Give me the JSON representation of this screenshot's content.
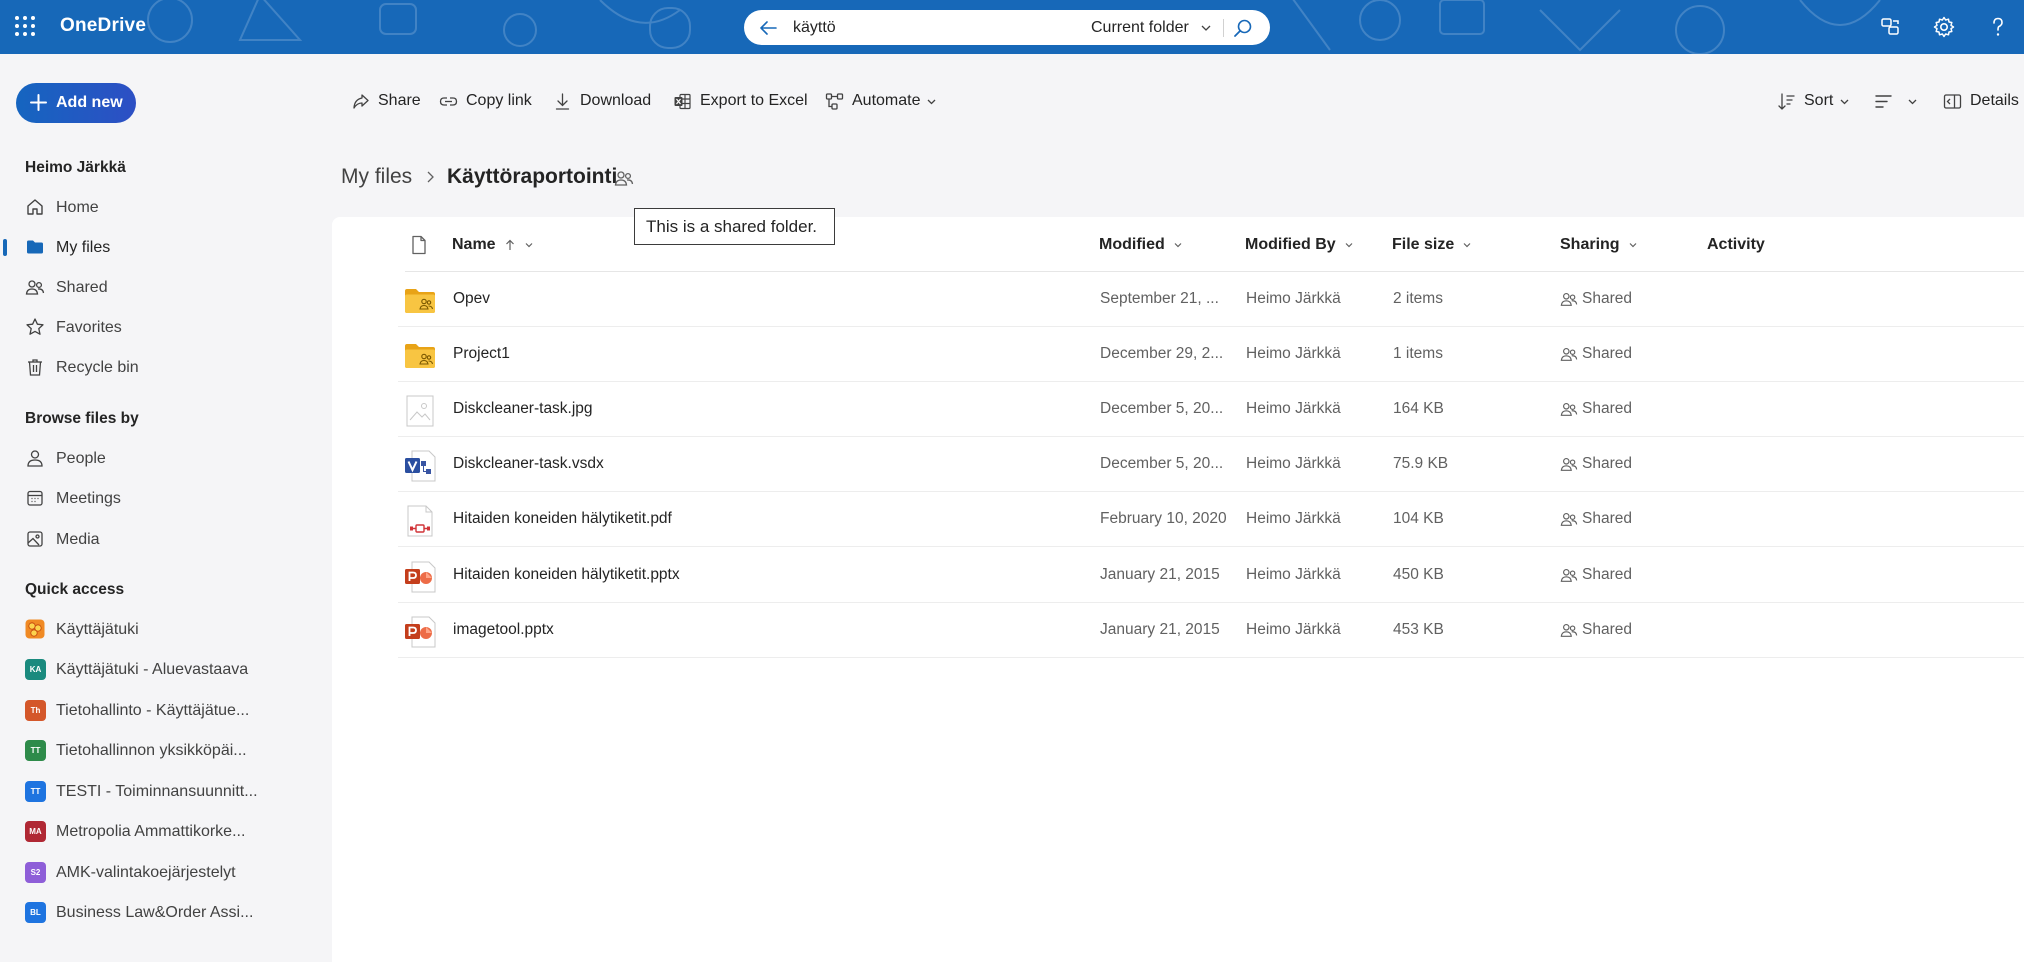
{
  "app": {
    "brand": "OneDrive"
  },
  "search": {
    "query": "käyttö",
    "scope": "Current folder"
  },
  "sidebar": {
    "add_new": "Add new",
    "user": "Heimo Järkkä",
    "nav": [
      {
        "label": "Home",
        "icon": "home-icon"
      },
      {
        "label": "My files",
        "icon": "folder-icon",
        "active": true
      },
      {
        "label": "Shared",
        "icon": "people-icon"
      },
      {
        "label": "Favorites",
        "icon": "star-icon"
      },
      {
        "label": "Recycle bin",
        "icon": "trash-icon"
      }
    ],
    "browse_head": "Browse files by",
    "browse": [
      {
        "label": "People",
        "icon": "person-icon"
      },
      {
        "label": "Meetings",
        "icon": "calendar-icon"
      },
      {
        "label": "Media",
        "icon": "image-icon"
      }
    ],
    "quick_head": "Quick access",
    "quick": [
      {
        "label": "Käyttäjätuki",
        "badge": "",
        "color": "#f4a23a"
      },
      {
        "label": "Käyttäjätuki - Aluevastaava",
        "badge": "KA",
        "color": "#1a8a7e"
      },
      {
        "label": "Tietohallinto - Käyttäjätue...",
        "badge": "Th",
        "color": "#d4572a"
      },
      {
        "label": "Tietohallinnon yksikköpäi...",
        "badge": "TT",
        "color": "#2e8b4a"
      },
      {
        "label": "TESTI - Toiminnansuunnitt...",
        "badge": "TT",
        "color": "#1e74e0"
      },
      {
        "label": "Metropolia Ammattikorke...",
        "badge": "MA",
        "color": "#b02834"
      },
      {
        "label": "AMK-valintakoejärjestelyt",
        "badge": "S2",
        "color": "#8e5ed8"
      },
      {
        "label": "Business Law&Order Assi...",
        "badge": "BL",
        "color": "#1e74e0"
      }
    ]
  },
  "toolbar": {
    "share": "Share",
    "copy_link": "Copy link",
    "download": "Download",
    "export": "Export to Excel",
    "automate": "Automate",
    "sort": "Sort",
    "details": "Details"
  },
  "breadcrumb": {
    "root": "My files",
    "current": "Käyttöraportointi"
  },
  "tooltip": "This is a shared folder.",
  "columns": {
    "name": "Name",
    "modified": "Modified",
    "modified_by": "Modified By",
    "file_size": "File size",
    "sharing": "Sharing",
    "activity": "Activity"
  },
  "files": [
    {
      "name": "Opev",
      "type": "shared-folder-icon",
      "modified": "September 21, ...",
      "by": "Heimo Järkkä",
      "size": "2 items",
      "sharing": "Shared"
    },
    {
      "name": "Project1",
      "type": "shared-folder-icon",
      "modified": "December 29, 2...",
      "by": "Heimo Järkkä",
      "size": "1 items",
      "sharing": "Shared"
    },
    {
      "name": "Diskcleaner-task.jpg",
      "type": "image-file-icon",
      "modified": "December 5, 20...",
      "by": "Heimo Järkkä",
      "size": "164 KB",
      "sharing": "Shared"
    },
    {
      "name": "Diskcleaner-task.vsdx",
      "type": "visio-file-icon",
      "modified": "December 5, 20...",
      "by": "Heimo Järkkä",
      "size": "75.9 KB",
      "sharing": "Shared"
    },
    {
      "name": "Hitaiden koneiden hälytiketit.pdf",
      "type": "pdf-file-icon",
      "modified": "February 10, 2020",
      "by": "Heimo Järkkä",
      "size": "104 KB",
      "sharing": "Shared"
    },
    {
      "name": "Hitaiden koneiden hälytiketit.pptx",
      "type": "powerpoint-file-icon",
      "modified": "January 21, 2015",
      "by": "Heimo Järkkä",
      "size": "450 KB",
      "sharing": "Shared"
    },
    {
      "name": "imagetool.pptx",
      "type": "powerpoint-file-icon",
      "modified": "January 21, 2015",
      "by": "Heimo Järkkä",
      "size": "453 KB",
      "sharing": "Shared"
    }
  ],
  "colors": {
    "topbar": "#1768b8",
    "accent": "#1768b8",
    "folder": "#f8c542"
  }
}
